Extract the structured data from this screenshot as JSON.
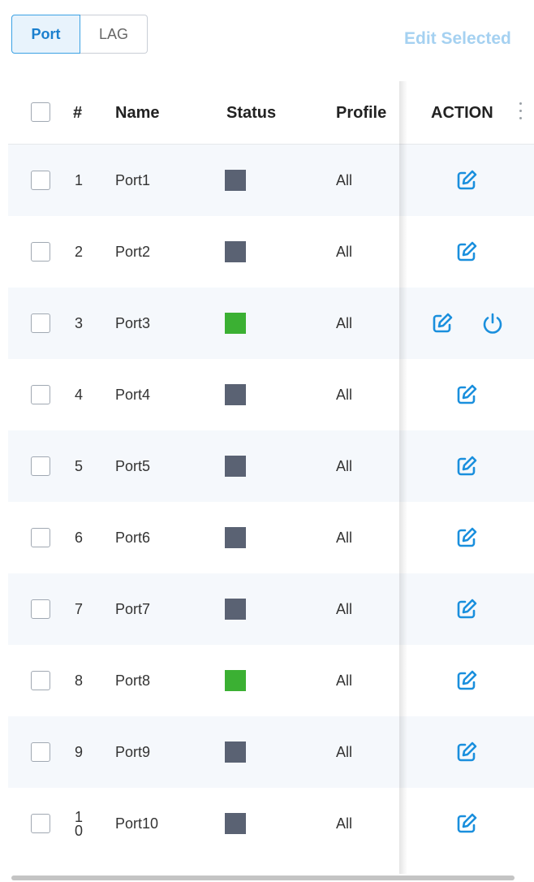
{
  "tabs": {
    "port": "Port",
    "lag": "LAG",
    "active": "Port"
  },
  "toolbar": {
    "edit_selected": "Edit Selected"
  },
  "columns": {
    "index": "#",
    "name": "Name",
    "status": "Status",
    "profile": "Profile",
    "action": "ACTION"
  },
  "colors": {
    "status_up": "#3bb033",
    "status_down": "#5a6273",
    "accent": "#1a8fdd",
    "edit_selected_disabled": "#a5d1f1"
  },
  "rows": [
    {
      "index": "1",
      "name": "Port1",
      "status": "down",
      "profile": "All",
      "actions": [
        "edit-icon"
      ]
    },
    {
      "index": "2",
      "name": "Port2",
      "status": "down",
      "profile": "All",
      "actions": [
        "edit-icon"
      ]
    },
    {
      "index": "3",
      "name": "Port3",
      "status": "up",
      "profile": "All",
      "actions": [
        "edit-icon",
        "power-icon"
      ]
    },
    {
      "index": "4",
      "name": "Port4",
      "status": "down",
      "profile": "All",
      "actions": [
        "edit-icon"
      ]
    },
    {
      "index": "5",
      "name": "Port5",
      "status": "down",
      "profile": "All",
      "actions": [
        "edit-icon"
      ]
    },
    {
      "index": "6",
      "name": "Port6",
      "status": "down",
      "profile": "All",
      "actions": [
        "edit-icon"
      ]
    },
    {
      "index": "7",
      "name": "Port7",
      "status": "down",
      "profile": "All",
      "actions": [
        "edit-icon"
      ]
    },
    {
      "index": "8",
      "name": "Port8",
      "status": "up",
      "profile": "All",
      "actions": [
        "edit-icon"
      ]
    },
    {
      "index": "9",
      "name": "Port9",
      "status": "down",
      "profile": "All",
      "actions": [
        "edit-icon"
      ]
    },
    {
      "index": "10",
      "name": "Port10",
      "status": "down",
      "profile": "All",
      "actions": [
        "edit-icon"
      ]
    }
  ]
}
